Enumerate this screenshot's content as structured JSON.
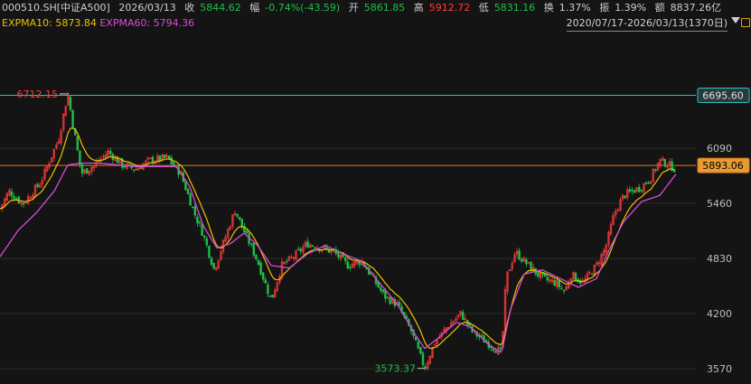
{
  "header": {
    "code": "000510.SH[中证A500]",
    "date": "2026/03/13",
    "close_label": "收",
    "close": "5844.62",
    "change_label": "幅",
    "change": "-0.74%(-43.59)",
    "open_label": "开",
    "open": "5861.85",
    "high_label": "高",
    "high": "5912.72",
    "low_label": "低",
    "low": "5831.16",
    "turnover_label": "换",
    "turnover": "1.37%",
    "amplitude_label": "振",
    "amplitude": "1.39%",
    "volume_label": "额",
    "volume": "8837.26亿"
  },
  "indicators": {
    "ma10": "EXPMA10: 5873.84",
    "ma60": "EXPMA60: 5794.36"
  },
  "range_selector": {
    "value": "2020/07/17-2026/03/13(1370日)"
  },
  "colors": {
    "background": "#141414",
    "up": "#ff3b3b",
    "down": "#1fbf4a",
    "ma10": "#f0c000",
    "ma60": "#d84bd8",
    "cyan_line": "#27c3c3",
    "orange_line": "#d97a20",
    "price_tag": "#e79b30"
  },
  "chart_data": {
    "type": "candlestick",
    "y_ticks": [
      "6090",
      "5460",
      "4830",
      "4200",
      "3570"
    ],
    "ylim": [
      3500,
      6900
    ],
    "reference_lines": [
      {
        "value": 6695.6,
        "label": "6695.60",
        "color": "#27c3c3"
      },
      {
        "value": 5893.06,
        "label": "5893.06",
        "color": "#d97a20"
      }
    ],
    "annotations": [
      {
        "text": "6712.15",
        "value": 6712.15
      },
      {
        "text": "3573.37",
        "value": 3573.37
      }
    ],
    "anchors": [
      [
        0,
        5400
      ],
      [
        10,
        5600
      ],
      [
        25,
        5450
      ],
      [
        45,
        5700
      ],
      [
        65,
        6200
      ],
      [
        75,
        6712.15
      ],
      [
        90,
        5800
      ],
      [
        105,
        5900
      ],
      [
        120,
        6050
      ],
      [
        135,
        5900
      ],
      [
        150,
        5850
      ],
      [
        165,
        5950
      ],
      [
        185,
        5980
      ],
      [
        200,
        5800
      ],
      [
        215,
        5350
      ],
      [
        225,
        5100
      ],
      [
        237,
        4700
      ],
      [
        247,
        5000
      ],
      [
        260,
        5380
      ],
      [
        272,
        5100
      ],
      [
        285,
        4800
      ],
      [
        300,
        4350
      ],
      [
        312,
        4750
      ],
      [
        325,
        4850
      ],
      [
        340,
        5000
      ],
      [
        355,
        4950
      ],
      [
        370,
        4900
      ],
      [
        385,
        4750
      ],
      [
        400,
        4800
      ],
      [
        410,
        4650
      ],
      [
        425,
        4400
      ],
      [
        440,
        4300
      ],
      [
        455,
        4000
      ],
      [
        470,
        3573.37
      ],
      [
        480,
        3850
      ],
      [
        495,
        4050
      ],
      [
        510,
        4200
      ],
      [
        522,
        4000
      ],
      [
        535,
        3900
      ],
      [
        548,
        3800
      ],
      [
        555,
        3750
      ],
      [
        560,
        4600
      ],
      [
        570,
        4900
      ],
      [
        585,
        4750
      ],
      [
        600,
        4600
      ],
      [
        615,
        4550
      ],
      [
        625,
        4450
      ],
      [
        632,
        4650
      ],
      [
        645,
        4550
      ],
      [
        660,
        4750
      ],
      [
        670,
        4950
      ],
      [
        680,
        5350
      ],
      [
        690,
        5550
      ],
      [
        700,
        5600
      ],
      [
        710,
        5650
      ],
      [
        720,
        5750
      ],
      [
        730,
        5950
      ],
      [
        740,
        5900
      ],
      [
        748,
        5844.62
      ]
    ],
    "ma_anchors": [
      [
        0,
        4850
      ],
      [
        20,
        5150
      ],
      [
        40,
        5350
      ],
      [
        60,
        5600
      ],
      [
        75,
        5900
      ],
      [
        90,
        5920
      ],
      [
        110,
        5920
      ],
      [
        130,
        5900
      ],
      [
        150,
        5880
      ],
      [
        175,
        5880
      ],
      [
        195,
        5880
      ],
      [
        210,
        5650
      ],
      [
        225,
        5200
      ],
      [
        240,
        4950
      ],
      [
        255,
        5000
      ],
      [
        270,
        5120
      ],
      [
        285,
        4980
      ],
      [
        300,
        4750
      ],
      [
        320,
        4720
      ],
      [
        340,
        4880
      ],
      [
        360,
        4980
      ],
      [
        380,
        4880
      ],
      [
        400,
        4800
      ],
      [
        420,
        4550
      ],
      [
        440,
        4300
      ],
      [
        460,
        3950
      ],
      [
        470,
        3800
      ],
      [
        485,
        3920
      ],
      [
        505,
        4100
      ],
      [
        520,
        4050
      ],
      [
        540,
        3850
      ],
      [
        555,
        3750
      ],
      [
        565,
        4250
      ],
      [
        580,
        4650
      ],
      [
        600,
        4700
      ],
      [
        620,
        4600
      ],
      [
        640,
        4500
      ],
      [
        660,
        4600
      ],
      [
        675,
        4950
      ],
      [
        690,
        5250
      ],
      [
        710,
        5480
      ],
      [
        730,
        5550
      ],
      [
        748,
        5794.36
      ]
    ]
  }
}
